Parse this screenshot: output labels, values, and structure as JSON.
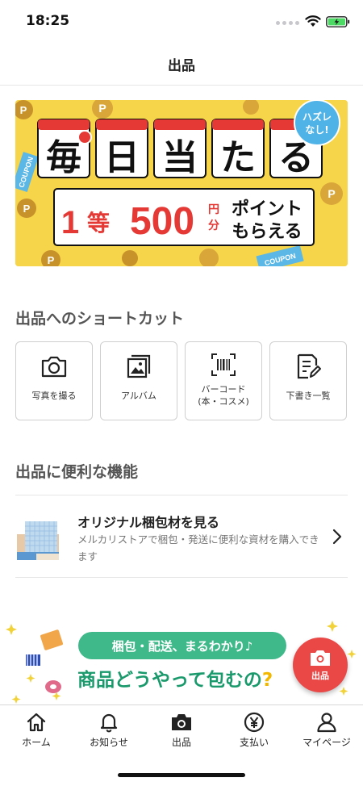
{
  "status_bar": {
    "time": "18:25"
  },
  "header": {
    "title": "出品"
  },
  "banner": {
    "chars": [
      "毎",
      "日",
      "当",
      "た",
      "る"
    ],
    "badge_line1": "ハズレ",
    "badge_line2": "なし!",
    "prize_rank": "1",
    "prize_rank_suffix": "等",
    "prize_amount": "500",
    "prize_unit_top": "円",
    "prize_unit_bottom": "分",
    "prize_text_line1": "ポイント",
    "prize_text_line2": "もらえる",
    "coupon_text": "COUPON",
    "coin_letter": "P",
    "colors": {
      "background": "#f7d54a",
      "red": "#e53935",
      "black": "#111111",
      "badge": "#4fb3e8"
    }
  },
  "shortcuts": {
    "title": "出品へのショートカット",
    "items": [
      {
        "label": "写真を撮る",
        "icon": "camera-icon"
      },
      {
        "label": "アルバム",
        "icon": "album-icon"
      },
      {
        "label": "バーコード\n(本・コスメ)",
        "icon": "barcode-icon"
      },
      {
        "label": "下書き一覧",
        "icon": "draft-list-icon"
      }
    ]
  },
  "features": {
    "title": "出品に便利な機能",
    "items": [
      {
        "title": "オリジナル梱包材を見る",
        "description": "メルカリストアで梱包・発送に便利な資材を購入できます",
        "icon": "packing-material-icon"
      }
    ]
  },
  "bottom_promo": {
    "pill_text": "梱包・配送、まるわかり♪",
    "headline": "商品どうやって包むの",
    "headline_mark": "?"
  },
  "fab": {
    "label": "出品",
    "color": "#e94847"
  },
  "tab_bar": {
    "items": [
      {
        "label": "ホーム",
        "icon": "home-icon"
      },
      {
        "label": "お知らせ",
        "icon": "bell-icon"
      },
      {
        "label": "出品",
        "icon": "camera-icon"
      },
      {
        "label": "支払い",
        "icon": "yen-icon"
      },
      {
        "label": "マイページ",
        "icon": "person-icon"
      }
    ]
  }
}
